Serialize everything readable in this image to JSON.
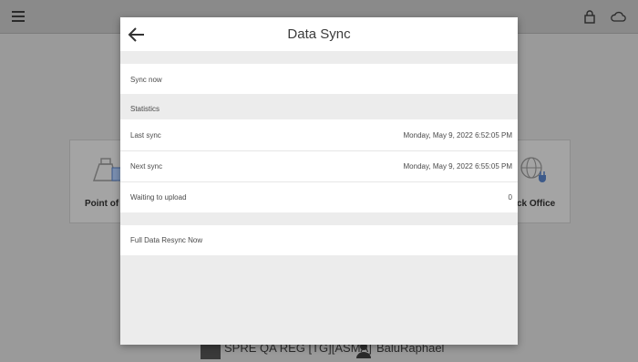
{
  "background": {
    "tiles": [
      {
        "label": "Point of S"
      },
      {
        "label": "ck Office"
      }
    ],
    "footer": {
      "store_name": "SPRE QA REG [TG][ASMA]",
      "user_name": "BaluRaphael"
    }
  },
  "modal": {
    "title": "Data Sync",
    "sync_now_label": "Sync now",
    "statistics_header": "Statistics",
    "last_sync": {
      "label": "Last sync",
      "value": "Monday, May 9, 2022 6:52:05 PM"
    },
    "next_sync": {
      "label": "Next sync",
      "value": "Monday, May 9, 2022 6:55:05 PM"
    },
    "waiting_upload": {
      "label": "Waiting to upload",
      "value": "0"
    },
    "full_resync_label": "Full Data Resync Now"
  }
}
